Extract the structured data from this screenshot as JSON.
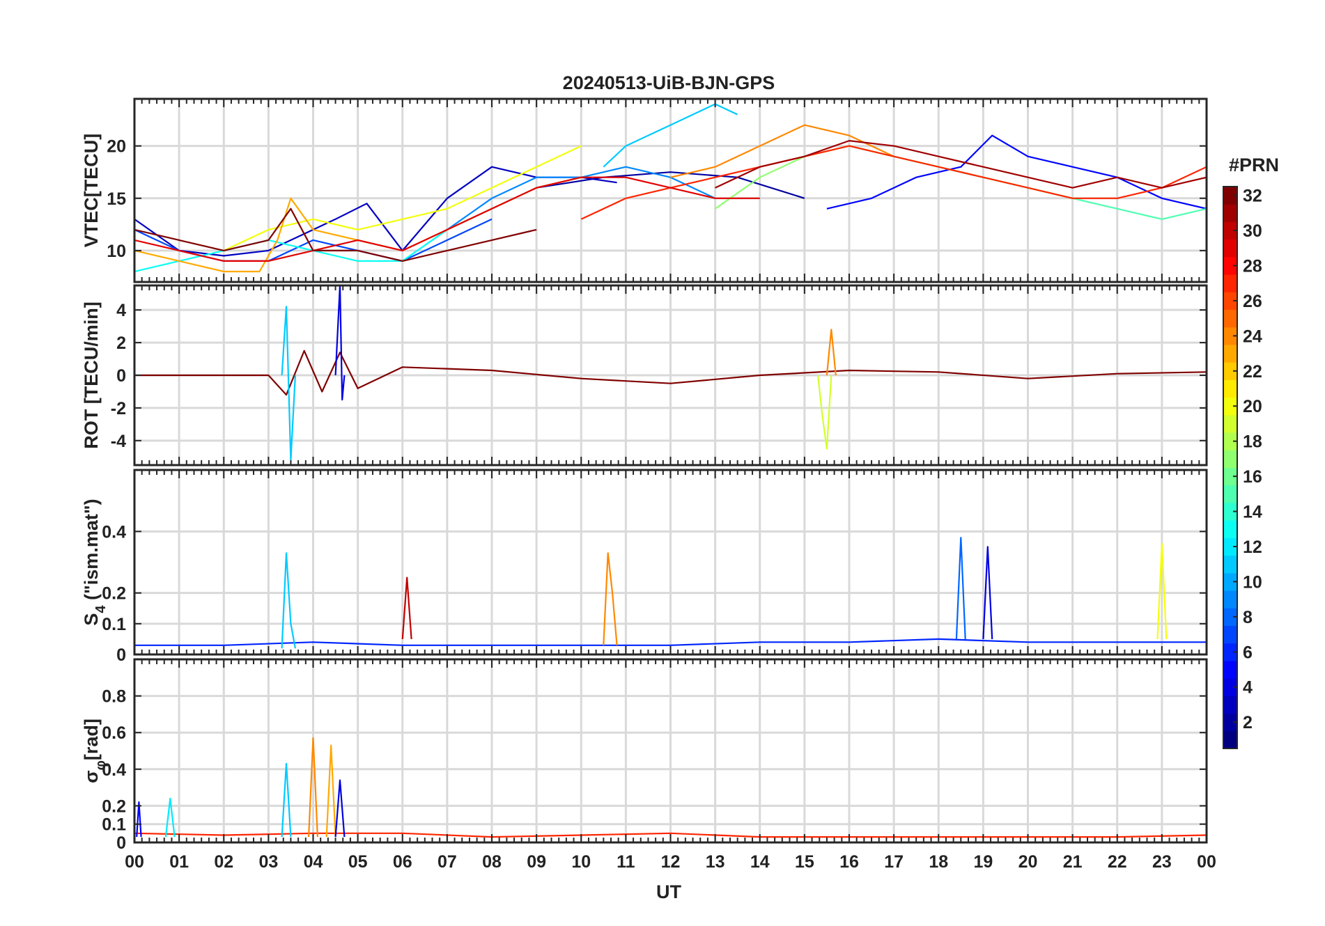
{
  "title": "20240513-UiB-BJN-GPS",
  "xlabel": "UT",
  "colorbar": {
    "title": "#PRN",
    "ticks": [
      "2",
      "4",
      "6",
      "8",
      "10",
      "12",
      "14",
      "16",
      "18",
      "20",
      "22",
      "24",
      "26",
      "28",
      "30",
      "32"
    ],
    "range": [
      1,
      32
    ],
    "colormap": "jet"
  },
  "chart_data": [
    {
      "type": "line",
      "ylabel": "VTEC[TECU]",
      "xlim": [
        0,
        24
      ],
      "ylim": [
        7,
        24.5
      ],
      "yticks": [
        "10",
        "15",
        "20"
      ],
      "xticks": [
        "00",
        "01",
        "02",
        "03",
        "04",
        "05",
        "06",
        "07",
        "08",
        "09",
        "10",
        "11",
        "12",
        "13",
        "14",
        "15",
        "16",
        "17",
        "18",
        "19",
        "20",
        "21",
        "22",
        "23",
        "00"
      ],
      "grid": true,
      "series": [
        {
          "prn": 2,
          "x": [
            9.0,
            10.5,
            12.0,
            13.5,
            15.0
          ],
          "y": [
            16,
            17,
            17.5,
            17,
            15
          ]
        },
        {
          "prn": 3,
          "x": [
            0,
            1,
            2,
            3,
            4,
            4.5,
            5.2,
            6,
            7,
            8,
            9,
            10,
            10.8
          ],
          "y": [
            13,
            10,
            9.5,
            10,
            12,
            13,
            14.5,
            10,
            15,
            18,
            17,
            17,
            16.5
          ]
        },
        {
          "prn": 5,
          "x": [
            15.5,
            16.5,
            17.5,
            18.5,
            19.2,
            20,
            21,
            22,
            23,
            24
          ],
          "y": [
            14,
            15,
            17,
            18,
            21,
            19,
            18,
            17,
            15,
            14
          ]
        },
        {
          "prn": 7,
          "x": [
            0,
            1,
            2,
            3,
            4,
            5,
            6,
            7,
            8
          ],
          "y": [
            12,
            10,
            9,
            9,
            11,
            10,
            9,
            11,
            13
          ]
        },
        {
          "prn": 9,
          "x": [
            6,
            7,
            8,
            9,
            10,
            11,
            12,
            13
          ],
          "y": [
            9,
            12,
            15,
            17,
            17,
            18,
            17,
            15
          ]
        },
        {
          "prn": 11,
          "x": [
            10.5,
            11,
            11.5,
            12,
            12.5,
            13,
            13.5
          ],
          "y": [
            18,
            20,
            21,
            22,
            23,
            24,
            23
          ]
        },
        {
          "prn": 13,
          "x": [
            0,
            1,
            2,
            3,
            4,
            5,
            6,
            7,
            8,
            9
          ],
          "y": [
            8,
            9,
            10,
            11,
            10,
            9,
            9,
            12,
            14,
            16
          ]
        },
        {
          "prn": 15,
          "x": [
            16,
            17,
            18,
            19,
            20,
            21,
            22,
            23,
            24
          ],
          "y": [
            20,
            19,
            18,
            17,
            16,
            15,
            14,
            13,
            14
          ]
        },
        {
          "prn": 17,
          "x": [
            13,
            14,
            15,
            16,
            17,
            18,
            19,
            20,
            21
          ],
          "y": [
            14,
            17,
            19,
            20,
            19,
            18,
            17,
            16,
            15
          ]
        },
        {
          "prn": 20,
          "x": [
            2,
            3,
            4,
            5,
            6,
            7,
            8,
            9,
            10
          ],
          "y": [
            10,
            12,
            13,
            12,
            13,
            14,
            16,
            18,
            20
          ]
        },
        {
          "prn": 23,
          "x": [
            0,
            1,
            2,
            2.8,
            3.2,
            3.5,
            4,
            5,
            6,
            7,
            8,
            9,
            10
          ],
          "y": [
            10,
            9,
            8,
            8,
            11,
            15,
            12,
            11,
            10,
            12,
            14,
            16,
            17
          ]
        },
        {
          "prn": 24,
          "x": [
            12,
            13,
            14,
            15,
            16,
            17
          ],
          "y": [
            17,
            18,
            20,
            22,
            21,
            19
          ]
        },
        {
          "prn": 27,
          "x": [
            10,
            11,
            12,
            13,
            14,
            15,
            16,
            17,
            18,
            19,
            20,
            21,
            22,
            23,
            24
          ],
          "y": [
            13,
            15,
            16,
            17,
            18,
            19,
            20,
            19,
            18,
            17,
            16,
            15,
            15,
            16,
            18
          ]
        },
        {
          "prn": 29,
          "x": [
            0,
            1,
            2,
            3,
            4,
            5,
            6,
            7,
            8,
            9,
            10,
            11,
            12,
            13,
            14
          ],
          "y": [
            11,
            10,
            9,
            9,
            10,
            11,
            10,
            12,
            14,
            16,
            17,
            17,
            16,
            15,
            15
          ]
        },
        {
          "prn": 31,
          "x": [
            13,
            14,
            15,
            16,
            17,
            18,
            19,
            20,
            21,
            22,
            23,
            24
          ],
          "y": [
            16,
            18,
            19,
            20.5,
            20,
            19,
            18,
            17,
            16,
            17,
            16,
            17
          ]
        },
        {
          "prn": 32,
          "x": [
            0,
            1,
            2,
            3,
            3.5,
            4,
            5,
            6,
            7,
            8,
            9
          ],
          "y": [
            12,
            11,
            10,
            11,
            14,
            10,
            10,
            9,
            10,
            11,
            12
          ]
        }
      ]
    },
    {
      "type": "line",
      "ylabel": "ROT [TECU/min]",
      "xlim": [
        0,
        24
      ],
      "ylim": [
        -5.5,
        5.5
      ],
      "yticks": [
        "-4",
        "-2",
        "0",
        "2",
        "4"
      ],
      "xticks": [
        "00",
        "01",
        "02",
        "03",
        "04",
        "05",
        "06",
        "07",
        "08",
        "09",
        "10",
        "11",
        "12",
        "13",
        "14",
        "15",
        "16",
        "17",
        "18",
        "19",
        "20",
        "21",
        "22",
        "23",
        "00"
      ],
      "grid": true,
      "series": [
        {
          "prn": 32,
          "x": [
            0,
            3,
            3.4,
            3.8,
            4.2,
            4.6,
            5,
            6,
            8,
            10,
            12,
            14,
            16,
            18,
            20,
            22,
            24
          ],
          "y": [
            0,
            0,
            -1.2,
            1.5,
            -1.0,
            1.4,
            -0.8,
            0.5,
            0.3,
            -0.2,
            -0.5,
            0,
            0.3,
            0.2,
            -0.2,
            0.1,
            0.2
          ]
        },
        {
          "prn": 11,
          "x": [
            3.3,
            3.4,
            3.5,
            3.6
          ],
          "y": [
            0,
            4.2,
            -5.2,
            0
          ]
        },
        {
          "prn": 4,
          "x": [
            4.5,
            4.6,
            4.65,
            4.7
          ],
          "y": [
            0,
            5.5,
            -1.5,
            0
          ]
        },
        {
          "prn": 19,
          "x": [
            15.3,
            15.4,
            15.5,
            15.6
          ],
          "y": [
            0,
            -2.5,
            -4.5,
            0
          ]
        },
        {
          "prn": 24,
          "x": [
            15.5,
            15.6,
            15.7
          ],
          "y": [
            0,
            2.8,
            0
          ]
        }
      ]
    },
    {
      "type": "line",
      "ylabel": "S4 (\"ism.mat\")",
      "ylabel_main": "S",
      "ylabel_sub": "4",
      "ylabel_rest": " (\"ism.mat\")",
      "xlim": [
        0,
        24
      ],
      "ylim": [
        0,
        0.6
      ],
      "yticks": [
        "0",
        "0.1",
        "0.2",
        "0.4"
      ],
      "xticks": [
        "00",
        "01",
        "02",
        "03",
        "04",
        "05",
        "06",
        "07",
        "08",
        "09",
        "10",
        "11",
        "12",
        "13",
        "14",
        "15",
        "16",
        "17",
        "18",
        "19",
        "20",
        "21",
        "22",
        "23",
        "00"
      ],
      "grid": true,
      "series": [
        {
          "prn": 6,
          "x": [
            0,
            2,
            4,
            6,
            8,
            10,
            12,
            14,
            16,
            18,
            20,
            22,
            24
          ],
          "y": [
            0.03,
            0.03,
            0.04,
            0.03,
            0.03,
            0.03,
            0.03,
            0.04,
            0.04,
            0.05,
            0.04,
            0.04,
            0.04
          ]
        },
        {
          "prn": 11,
          "x": [
            3.3,
            3.4,
            3.5,
            3.6
          ],
          "y": [
            0.02,
            0.33,
            0.1,
            0.02
          ]
        },
        {
          "prn": 24,
          "x": [
            10.5,
            10.6,
            10.7,
            10.8
          ],
          "y": [
            0.03,
            0.33,
            0.2,
            0.03
          ]
        },
        {
          "prn": 20,
          "x": [
            22.9,
            23.0,
            23.1
          ],
          "y": [
            0.05,
            0.36,
            0.05
          ]
        },
        {
          "prn": 8,
          "x": [
            18.4,
            18.5,
            18.6
          ],
          "y": [
            0.05,
            0.38,
            0.05
          ]
        },
        {
          "prn": 4,
          "x": [
            19.0,
            19.1,
            19.2
          ],
          "y": [
            0.05,
            0.35,
            0.05
          ]
        },
        {
          "prn": 30,
          "x": [
            6.0,
            6.1,
            6.2
          ],
          "y": [
            0.05,
            0.25,
            0.05
          ]
        }
      ]
    },
    {
      "type": "line",
      "ylabel": "σφ[rad]",
      "ylabel_main": "σ",
      "ylabel_sub": "φ",
      "ylabel_rest": "[rad]",
      "xlim": [
        0,
        24
      ],
      "ylim": [
        0,
        1.0
      ],
      "yticks": [
        "0",
        "0.1",
        "0.2",
        "0.4",
        "0.6",
        "0.8"
      ],
      "xticks": [
        "00",
        "01",
        "02",
        "03",
        "04",
        "05",
        "06",
        "07",
        "08",
        "09",
        "10",
        "11",
        "12",
        "13",
        "14",
        "15",
        "16",
        "17",
        "18",
        "19",
        "20",
        "21",
        "22",
        "23",
        "00"
      ],
      "grid": true,
      "series": [
        {
          "prn": 27,
          "x": [
            0,
            2,
            4,
            6,
            8,
            10,
            12,
            14,
            16,
            18,
            20,
            22,
            24
          ],
          "y": [
            0.05,
            0.04,
            0.05,
            0.05,
            0.03,
            0.04,
            0.05,
            0.03,
            0.03,
            0.03,
            0.03,
            0.03,
            0.04
          ]
        },
        {
          "prn": 11,
          "x": [
            3.3,
            3.4,
            3.5
          ],
          "y": [
            0.03,
            0.43,
            0.03
          ]
        },
        {
          "prn": 24,
          "x": [
            3.9,
            4.0,
            4.1
          ],
          "y": [
            0.03,
            0.57,
            0.03
          ]
        },
        {
          "prn": 23,
          "x": [
            4.3,
            4.4,
            4.5
          ],
          "y": [
            0.03,
            0.53,
            0.03
          ]
        },
        {
          "prn": 4,
          "x": [
            4.5,
            4.6,
            4.7
          ],
          "y": [
            0.03,
            0.34,
            0.03
          ]
        },
        {
          "prn": 12,
          "x": [
            0.7,
            0.8,
            0.9
          ],
          "y": [
            0.03,
            0.24,
            0.03
          ]
        },
        {
          "prn": 5,
          "x": [
            0.05,
            0.1,
            0.15
          ],
          "y": [
            0.03,
            0.22,
            0.03
          ]
        }
      ]
    }
  ]
}
